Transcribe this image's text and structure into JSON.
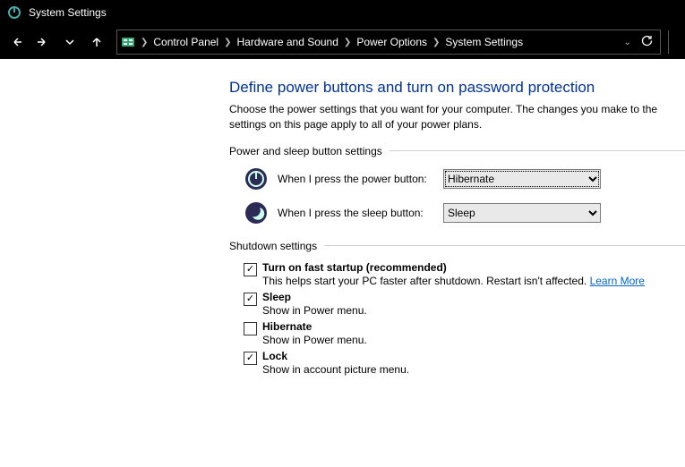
{
  "window": {
    "title": "System Settings"
  },
  "breadcrumb": {
    "items": [
      "Control Panel",
      "Hardware and Sound",
      "Power Options",
      "System Settings"
    ]
  },
  "page": {
    "heading": "Define power buttons and turn on password protection",
    "description": "Choose the power settings that you want for your computer. The changes you make to the settings on this page apply to all of your power plans."
  },
  "group1": {
    "title": "Power and sleep button settings"
  },
  "powerBtn": {
    "label": "When I press the power button:",
    "value": "Hibernate"
  },
  "sleepBtn": {
    "label": "When I press the sleep button:",
    "value": "Sleep"
  },
  "group2": {
    "title": "Shutdown settings"
  },
  "fastStartup": {
    "title": "Turn on fast startup (recommended)",
    "sub_prefix": "This helps start your PC faster after shutdown. Restart isn't affected. ",
    "learn": "Learn More"
  },
  "sleep": {
    "title": "Sleep",
    "sub": "Show in Power menu."
  },
  "hibernate": {
    "title": "Hibernate",
    "sub": "Show in Power menu."
  },
  "lock": {
    "title": "Lock",
    "sub": "Show in account picture menu."
  }
}
